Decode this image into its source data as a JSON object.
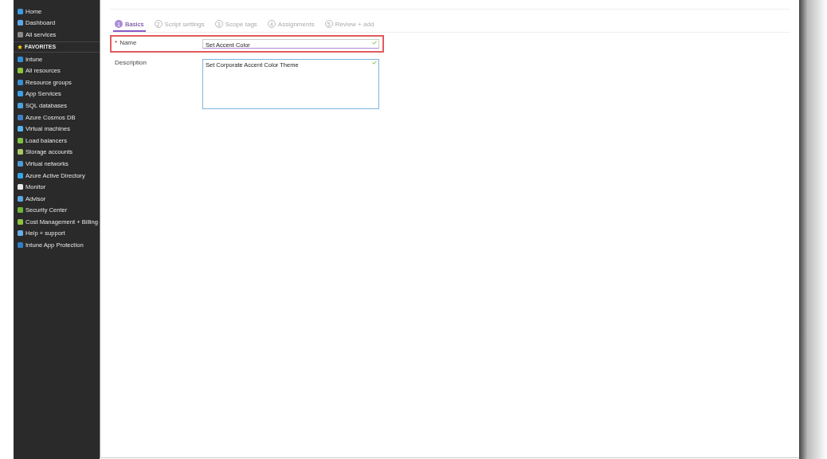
{
  "sidebar": {
    "items": [
      {
        "label": "Home",
        "kind": "item",
        "color": "#3a9be0"
      },
      {
        "label": "Dashboard",
        "kind": "item",
        "color": "#5ea8e8"
      },
      {
        "label": "All services",
        "kind": "item",
        "color": "#8a8a8a"
      },
      {
        "label": "FAVORITES",
        "kind": "header",
        "color": "#f2c811"
      },
      {
        "label": "Intune",
        "kind": "item",
        "color": "#2f8fd8"
      },
      {
        "label": "All resources",
        "kind": "item",
        "color": "#8cc43f"
      },
      {
        "label": "Resource groups",
        "kind": "item",
        "color": "#3a8fd0"
      },
      {
        "label": "App Services",
        "kind": "item",
        "color": "#3ea0e6"
      },
      {
        "label": "SQL databases",
        "kind": "item",
        "color": "#4aa3df"
      },
      {
        "label": "Azure Cosmos DB",
        "kind": "item",
        "color": "#3d7fc2"
      },
      {
        "label": "Virtual machines",
        "kind": "item",
        "color": "#58b4ec"
      },
      {
        "label": "Load balancers",
        "kind": "item",
        "color": "#7cc142"
      },
      {
        "label": "Storage accounts",
        "kind": "item",
        "color": "#a5c964"
      },
      {
        "label": "Virtual networks",
        "kind": "item",
        "color": "#4f9bd6"
      },
      {
        "label": "Azure Active Directory",
        "kind": "item",
        "color": "#38a4e8"
      },
      {
        "label": "Monitor",
        "kind": "item",
        "color": "#e8e8e8"
      },
      {
        "label": "Advisor",
        "kind": "item",
        "color": "#5ba7e0"
      },
      {
        "label": "Security Center",
        "kind": "item",
        "color": "#6fb53a"
      },
      {
        "label": "Cost Management + Billing",
        "kind": "item",
        "color": "#8cc43f"
      },
      {
        "label": "Help + support",
        "kind": "item",
        "color": "#6aaee6"
      },
      {
        "label": "Intune App Protection",
        "kind": "item",
        "color": "#2f7fc8"
      }
    ]
  },
  "tabs": [
    {
      "number": "1",
      "label": "Basics",
      "selected": true
    },
    {
      "number": "2",
      "label": "Script settings",
      "selected": false
    },
    {
      "number": "3",
      "label": "Scope tags",
      "selected": false
    },
    {
      "number": "4",
      "label": "Assignments",
      "selected": false
    },
    {
      "number": "5",
      "label": "Review + add",
      "selected": false
    }
  ],
  "form": {
    "fields": [
      {
        "kind": "input",
        "required": true,
        "required_mark": "*",
        "highlighted": true,
        "label": "Name",
        "value": "Set Accent Color",
        "valid": true
      },
      {
        "kind": "textarea",
        "required": false,
        "highlighted": false,
        "label": "Description",
        "value": "Set Corporate Accent Color Theme",
        "valid": true
      }
    ]
  }
}
